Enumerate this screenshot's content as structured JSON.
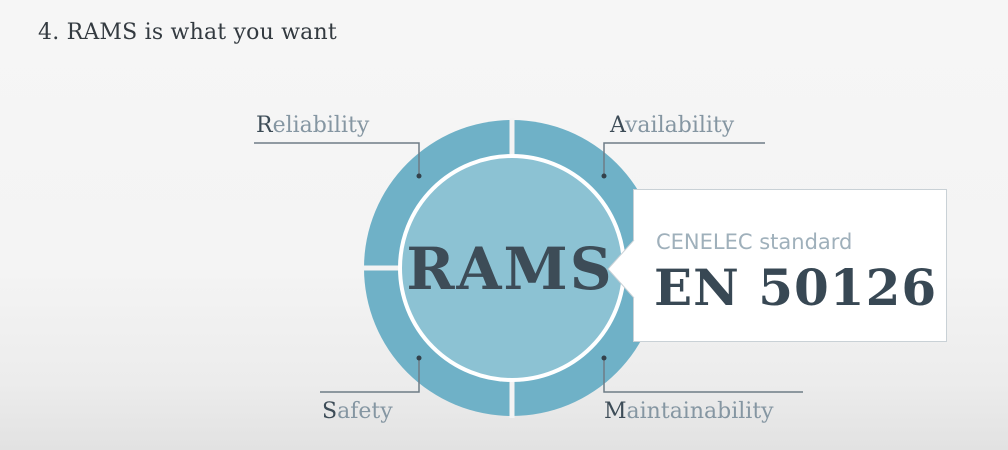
{
  "slide": {
    "title": "4. RAMS is what you want"
  },
  "diagram": {
    "center_label": "RAMS",
    "quadrants": [
      {
        "initial": "R",
        "rest": "eliability"
      },
      {
        "initial": "A",
        "rest": "vailability"
      },
      {
        "initial": "S",
        "rest": "afety"
      },
      {
        "initial": "M",
        "rest": "aintainability"
      }
    ],
    "colors": {
      "ring": "#6fb1c7",
      "inner_circle": "#8cc2d3",
      "inner_border": "#ffffff",
      "text_dark": "#3d4c57",
      "text_muted": "#8596a2"
    }
  },
  "callout": {
    "subtitle": "CENELEC standard",
    "standard": "EN 50126"
  }
}
